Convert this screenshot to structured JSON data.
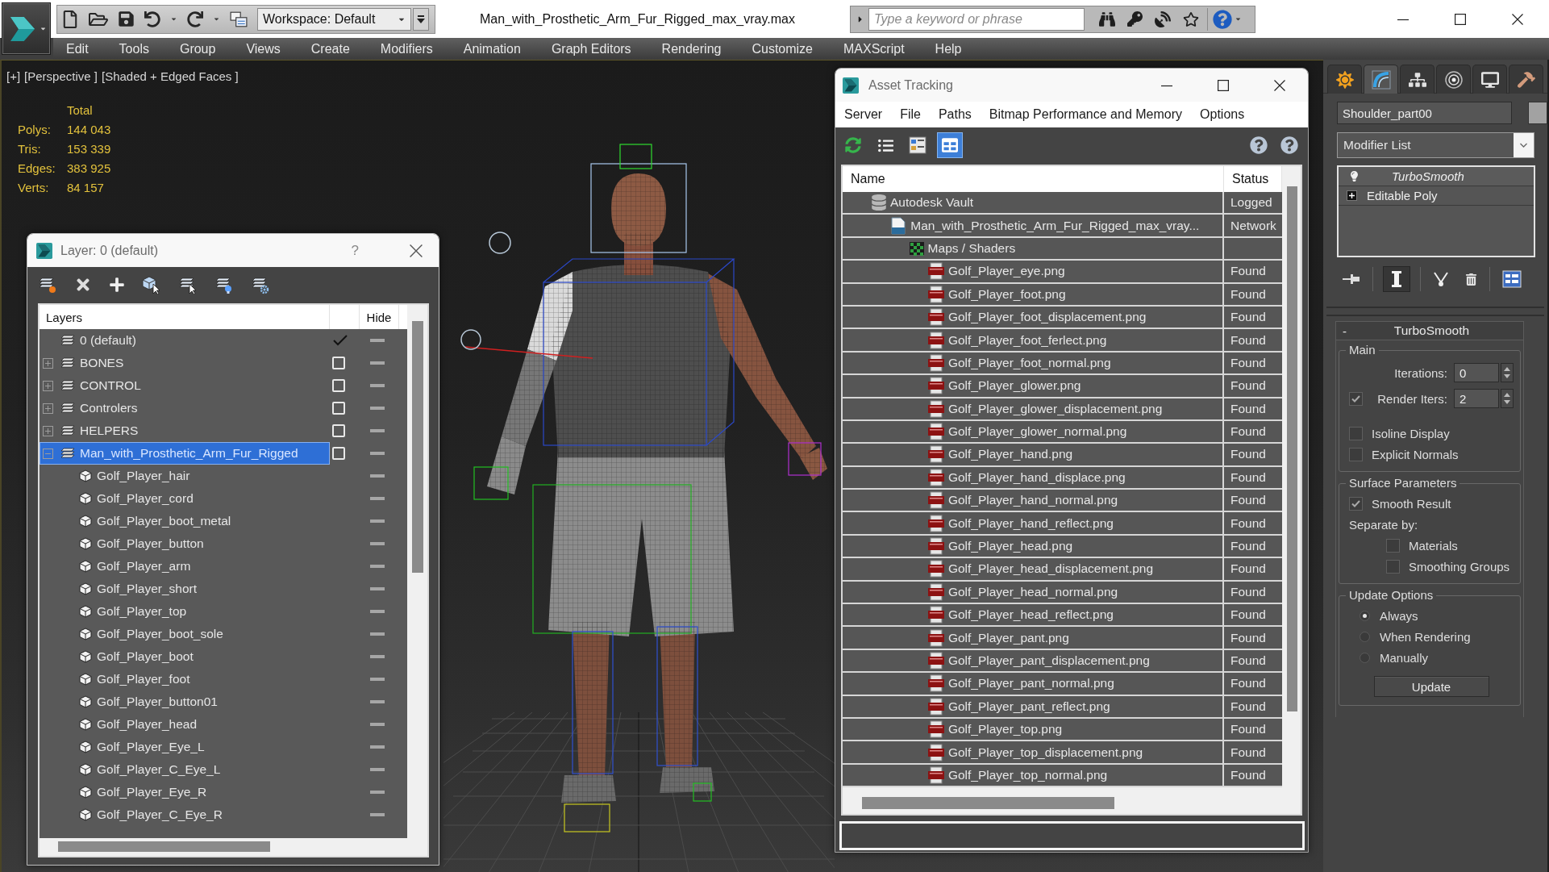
{
  "title_bar": {
    "workspace": "Workspace: Default",
    "document_title": "Man_with_Prosthetic_Arm_Fur_Rigged_max_vray.max",
    "search": {
      "placeholder": "Type a keyword or phrase"
    }
  },
  "menu_bar": [
    "Edit",
    "Tools",
    "Group",
    "Views",
    "Create",
    "Modifiers",
    "Animation",
    "Graph Editors",
    "Rendering",
    "Customize",
    "MAXScript",
    "Help"
  ],
  "viewport": {
    "labels": [
      "[+]",
      "[Perspective ]",
      "[Shaded + Edged Faces ]"
    ],
    "stats": {
      "heading": "Total",
      "rows": [
        {
          "label": "Polys:",
          "value": "144 043"
        },
        {
          "label": "Tris:",
          "value": "153 339"
        },
        {
          "label": "Edges:",
          "value": "383 925"
        },
        {
          "label": "Verts:",
          "value": "84 157"
        }
      ]
    }
  },
  "layer_explorer": {
    "title": "Layer: 0 (default)",
    "help": "?",
    "columns": [
      "Layers",
      "Hide"
    ],
    "layers": [
      {
        "name": "0 (default)",
        "kind": "layer",
        "selected": false,
        "active": true
      },
      {
        "name": "BONES",
        "kind": "layer",
        "selected": false,
        "active": false,
        "expanded": false
      },
      {
        "name": "CONTROL",
        "kind": "layer",
        "selected": false,
        "active": false,
        "expanded": false
      },
      {
        "name": "Controlers",
        "kind": "layer",
        "selected": false,
        "active": false,
        "expanded": false
      },
      {
        "name": "HELPERS",
        "kind": "layer",
        "selected": false,
        "active": false,
        "expanded": false
      },
      {
        "name": "Man_with_Prosthetic_Arm_Fur_Rigged",
        "kind": "layer",
        "selected": true,
        "active": false,
        "expanded": true,
        "children": [
          {
            "name": "Golf_Player_hair",
            "kind": "object",
            "selected": false
          },
          {
            "name": "Golf_Player_cord",
            "kind": "object",
            "selected": false
          },
          {
            "name": "Golf_Player_boot_metal",
            "kind": "object",
            "selected": false
          },
          {
            "name": "Golf_Player_button",
            "kind": "object",
            "selected": false
          },
          {
            "name": "Golf_Player_arm",
            "kind": "object",
            "selected": false
          },
          {
            "name": "Golf_Player_short",
            "kind": "object",
            "selected": false
          },
          {
            "name": "Golf_Player_top",
            "kind": "object",
            "selected": false
          },
          {
            "name": "Golf_Player_boot_sole",
            "kind": "object",
            "selected": false
          },
          {
            "name": "Golf_Player_boot",
            "kind": "object",
            "selected": false
          },
          {
            "name": "Golf_Player_foot",
            "kind": "object",
            "selected": false
          },
          {
            "name": "Golf_Player_button01",
            "kind": "object",
            "selected": false
          },
          {
            "name": "Golf_Player_head",
            "kind": "object",
            "selected": false
          },
          {
            "name": "Golf_Player_Eye_L",
            "kind": "object",
            "selected": false
          },
          {
            "name": "Golf_Player_C_Eye_L",
            "kind": "object",
            "selected": false
          },
          {
            "name": "Golf_Player_Eye_R",
            "kind": "object",
            "selected": false
          },
          {
            "name": "Golf_Player_C_Eye_R",
            "kind": "object",
            "selected": false
          }
        ]
      }
    ]
  },
  "asset_tracking": {
    "title": "Asset Tracking",
    "menu": [
      "Server",
      "File",
      "Paths",
      "Bitmap Performance and Memory",
      "Options"
    ],
    "toolbar": [
      {
        "kind": "refresh",
        "selected": false
      },
      {
        "kind": "list",
        "selected": false
      },
      {
        "kind": "thumbnails",
        "selected": false
      },
      {
        "kind": "table",
        "selected": true
      }
    ],
    "columns": [
      "Name",
      "Status"
    ],
    "tree": [
      {
        "name": "Autodesk Vault",
        "kind": "vault",
        "status": "Logged",
        "children": [
          {
            "name": "Man_with_Prosthetic_Arm_Fur_Rigged_max_vray...",
            "kind": "max-file",
            "status": "Network",
            "children": [
              {
                "name": "Maps / Shaders",
                "kind": "maps",
                "children": [
                  {
                    "name": "Golf_Player_eye.png",
                    "kind": "png",
                    "status": "Found"
                  },
                  {
                    "name": "Golf_Player_foot.png",
                    "kind": "png",
                    "status": "Found"
                  },
                  {
                    "name": "Golf_Player_foot_displacement.png",
                    "kind": "png",
                    "status": "Found"
                  },
                  {
                    "name": "Golf_Player_foot_ferlect.png",
                    "kind": "png",
                    "status": "Found"
                  },
                  {
                    "name": "Golf_Player_foot_normal.png",
                    "kind": "png",
                    "status": "Found"
                  },
                  {
                    "name": "Golf_Player_glower.png",
                    "kind": "png",
                    "status": "Found"
                  },
                  {
                    "name": "Golf_Player_glower_displacement.png",
                    "kind": "png",
                    "status": "Found"
                  },
                  {
                    "name": "Golf_Player_glower_normal.png",
                    "kind": "png",
                    "status": "Found"
                  },
                  {
                    "name": "Golf_Player_hand.png",
                    "kind": "png",
                    "status": "Found"
                  },
                  {
                    "name": "Golf_Player_hand_displace.png",
                    "kind": "png",
                    "status": "Found"
                  },
                  {
                    "name": "Golf_Player_hand_normal.png",
                    "kind": "png",
                    "status": "Found"
                  },
                  {
                    "name": "Golf_Player_hand_reflect.png",
                    "kind": "png",
                    "status": "Found"
                  },
                  {
                    "name": "Golf_Player_head.png",
                    "kind": "png",
                    "status": "Found"
                  },
                  {
                    "name": "Golf_Player_head_displacement.png",
                    "kind": "png",
                    "status": "Found"
                  },
                  {
                    "name": "Golf_Player_head_normal.png",
                    "kind": "png",
                    "status": "Found"
                  },
                  {
                    "name": "Golf_Player_head_reflect.png",
                    "kind": "png",
                    "status": "Found"
                  },
                  {
                    "name": "Golf_Player_pant.png",
                    "kind": "png",
                    "status": "Found"
                  },
                  {
                    "name": "Golf_Player_pant_displacement.png",
                    "kind": "png",
                    "status": "Found"
                  },
                  {
                    "name": "Golf_Player_pant_normal.png",
                    "kind": "png",
                    "status": "Found"
                  },
                  {
                    "name": "Golf_Player_pant_reflect.png",
                    "kind": "png",
                    "status": "Found"
                  },
                  {
                    "name": "Golf_Player_top.png",
                    "kind": "png",
                    "status": "Found"
                  },
                  {
                    "name": "Golf_Player_top_displacement.png",
                    "kind": "png",
                    "status": "Found"
                  },
                  {
                    "name": "Golf_Player_top_normal.png",
                    "kind": "png",
                    "status": "Found"
                  }
                ]
              }
            ]
          }
        ]
      }
    ]
  },
  "command_panel": {
    "tabs": [
      {
        "kind": "create",
        "selected": false
      },
      {
        "kind": "modify",
        "selected": true
      },
      {
        "kind": "hierarchy",
        "selected": false
      },
      {
        "kind": "motion",
        "selected": false
      },
      {
        "kind": "display",
        "selected": false
      },
      {
        "kind": "utilities",
        "selected": false
      }
    ],
    "object_name": "Shoulder_part00",
    "modifier_list": "Modifier List",
    "stack": [
      {
        "name": "TurboSmooth",
        "kind": "modifier"
      },
      {
        "name": "Editable Poly",
        "kind": "base-object"
      }
    ],
    "stack_tools": [
      [
        {
          "kind": "pin",
          "on": false
        }
      ],
      [
        {
          "kind": "end-result",
          "on": true
        }
      ],
      [
        {
          "kind": "make-unique",
          "on": false
        },
        {
          "kind": "remove",
          "on": false
        }
      ],
      [
        {
          "kind": "configure",
          "on": false
        }
      ]
    ],
    "rollout": {
      "toggle": "-",
      "title": "TurboSmooth",
      "groups": [
        {
          "title": "Main",
          "controls": [
            {
              "kind": "spinner",
              "label": "Iterations:",
              "value": "0"
            },
            {
              "kind": "check-spinner",
              "label": "Render Iters:",
              "value": "2",
              "checked": true
            },
            {
              "kind": "checkbox",
              "label": "Isoline Display",
              "checked": false
            },
            {
              "kind": "checkbox",
              "label": "Explicit Normals",
              "checked": false
            }
          ]
        },
        {
          "title": "Surface Parameters",
          "controls": [
            {
              "kind": "checkbox",
              "label": "Smooth Result",
              "checked": true
            },
            {
              "kind": "label",
              "label": "Separate by:",
              "children": [
                {
                  "kind": "checkbox",
                  "label": "Materials",
                  "checked": false
                },
                {
                  "kind": "checkbox",
                  "label": "Smoothing Groups",
                  "checked": false
                }
              ]
            }
          ]
        },
        {
          "title": "Update Options",
          "controls": [
            {
              "kind": "radio",
              "label": "Always",
              "selected": true
            },
            {
              "kind": "radio",
              "label": "When Rendering",
              "selected": false
            },
            {
              "kind": "radio",
              "label": "Manually",
              "selected": false
            },
            {
              "kind": "button",
              "label": "Update"
            }
          ]
        }
      ]
    }
  }
}
